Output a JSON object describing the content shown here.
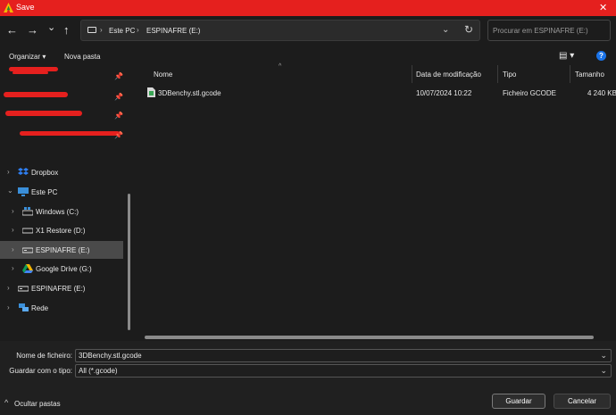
{
  "window": {
    "title": "Save",
    "close_glyph": "✕"
  },
  "nav": {
    "back_glyph": "←",
    "forward_glyph": "→",
    "recent_glyph": "⌄",
    "up_glyph": "↑",
    "address": {
      "crumbs": [
        "Este PC",
        "ESPINAFRE (E:)"
      ],
      "separator": "›",
      "dropdown_glyph": "⌄",
      "refresh_glyph": "↻"
    },
    "search": {
      "placeholder": "Procurar em ESPINAFRE (E:)"
    }
  },
  "toolbar": {
    "organize_label": "Organizar ▾",
    "new_folder_label": "Nova pasta",
    "view_glyph": "▤ ▾",
    "help_glyph": "?"
  },
  "sidebar": {
    "pin_glyph": "📌",
    "items": [
      {
        "label": "Dropbox",
        "icon": "dropbox-icon"
      },
      {
        "label": "Este PC",
        "icon": "computer-icon",
        "expanded": true
      },
      {
        "label": "Windows (C:)",
        "icon": "windows-drive-icon"
      },
      {
        "label": "X1 Restore  (D:)",
        "icon": "drive-icon"
      },
      {
        "label": "ESPINAFRE (E:)",
        "icon": "usb-drive-icon",
        "selected": true
      },
      {
        "label": "Google Drive (G:)",
        "icon": "google-drive-icon"
      },
      {
        "label": "ESPINAFRE (E:)",
        "icon": "usb-drive-icon"
      },
      {
        "label": "Rede",
        "icon": "network-icon"
      }
    ]
  },
  "file_list": {
    "sort_glyph": "^",
    "columns": [
      "Nome",
      "Data de modificação",
      "Tipo",
      "Tamanho"
    ],
    "rows": [
      {
        "name": "3DBenchy.stl.gcode",
        "modified": "10/07/2024 10:22",
        "type": "Ficheiro GCODE",
        "size": "4 240 KB"
      }
    ]
  },
  "save_form": {
    "filename_label": "Nome de ficheiro:",
    "filename_value": "3DBenchy.stl.gcode",
    "filetype_label": "Guardar com o tipo:",
    "filetype_value": "All (*.gcode)",
    "hide_folders_label": "Ocultar pastas",
    "save_label": "Guardar",
    "cancel_label": "Cancelar"
  },
  "colors": {
    "titlebar": "#e5201e",
    "background": "#1c1c1c",
    "selected_row": "#4a4a4a",
    "help_blue": "#1a73e8"
  }
}
